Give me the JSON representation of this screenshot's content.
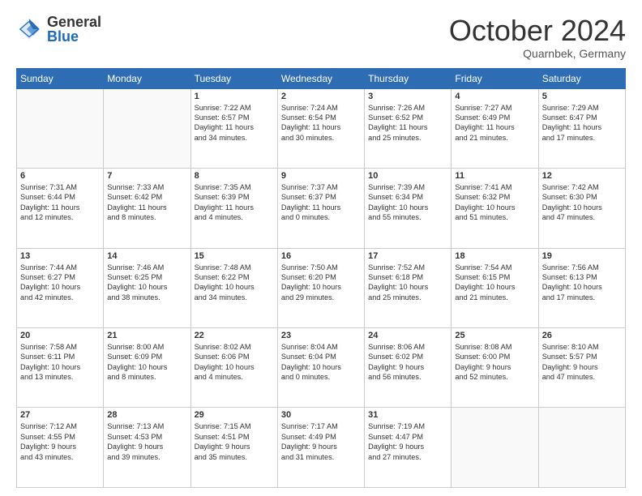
{
  "header": {
    "logo_general": "General",
    "logo_blue": "Blue",
    "month_title": "October 2024",
    "location": "Quarnbek, Germany"
  },
  "weekdays": [
    "Sunday",
    "Monday",
    "Tuesday",
    "Wednesday",
    "Thursday",
    "Friday",
    "Saturday"
  ],
  "weeks": [
    [
      {
        "day": "",
        "lines": []
      },
      {
        "day": "",
        "lines": []
      },
      {
        "day": "1",
        "lines": [
          "Sunrise: 7:22 AM",
          "Sunset: 6:57 PM",
          "Daylight: 11 hours",
          "and 34 minutes."
        ]
      },
      {
        "day": "2",
        "lines": [
          "Sunrise: 7:24 AM",
          "Sunset: 6:54 PM",
          "Daylight: 11 hours",
          "and 30 minutes."
        ]
      },
      {
        "day": "3",
        "lines": [
          "Sunrise: 7:26 AM",
          "Sunset: 6:52 PM",
          "Daylight: 11 hours",
          "and 25 minutes."
        ]
      },
      {
        "day": "4",
        "lines": [
          "Sunrise: 7:27 AM",
          "Sunset: 6:49 PM",
          "Daylight: 11 hours",
          "and 21 minutes."
        ]
      },
      {
        "day": "5",
        "lines": [
          "Sunrise: 7:29 AM",
          "Sunset: 6:47 PM",
          "Daylight: 11 hours",
          "and 17 minutes."
        ]
      }
    ],
    [
      {
        "day": "6",
        "lines": [
          "Sunrise: 7:31 AM",
          "Sunset: 6:44 PM",
          "Daylight: 11 hours",
          "and 12 minutes."
        ]
      },
      {
        "day": "7",
        "lines": [
          "Sunrise: 7:33 AM",
          "Sunset: 6:42 PM",
          "Daylight: 11 hours",
          "and 8 minutes."
        ]
      },
      {
        "day": "8",
        "lines": [
          "Sunrise: 7:35 AM",
          "Sunset: 6:39 PM",
          "Daylight: 11 hours",
          "and 4 minutes."
        ]
      },
      {
        "day": "9",
        "lines": [
          "Sunrise: 7:37 AM",
          "Sunset: 6:37 PM",
          "Daylight: 11 hours",
          "and 0 minutes."
        ]
      },
      {
        "day": "10",
        "lines": [
          "Sunrise: 7:39 AM",
          "Sunset: 6:34 PM",
          "Daylight: 10 hours",
          "and 55 minutes."
        ]
      },
      {
        "day": "11",
        "lines": [
          "Sunrise: 7:41 AM",
          "Sunset: 6:32 PM",
          "Daylight: 10 hours",
          "and 51 minutes."
        ]
      },
      {
        "day": "12",
        "lines": [
          "Sunrise: 7:42 AM",
          "Sunset: 6:30 PM",
          "Daylight: 10 hours",
          "and 47 minutes."
        ]
      }
    ],
    [
      {
        "day": "13",
        "lines": [
          "Sunrise: 7:44 AM",
          "Sunset: 6:27 PM",
          "Daylight: 10 hours",
          "and 42 minutes."
        ]
      },
      {
        "day": "14",
        "lines": [
          "Sunrise: 7:46 AM",
          "Sunset: 6:25 PM",
          "Daylight: 10 hours",
          "and 38 minutes."
        ]
      },
      {
        "day": "15",
        "lines": [
          "Sunrise: 7:48 AM",
          "Sunset: 6:22 PM",
          "Daylight: 10 hours",
          "and 34 minutes."
        ]
      },
      {
        "day": "16",
        "lines": [
          "Sunrise: 7:50 AM",
          "Sunset: 6:20 PM",
          "Daylight: 10 hours",
          "and 29 minutes."
        ]
      },
      {
        "day": "17",
        "lines": [
          "Sunrise: 7:52 AM",
          "Sunset: 6:18 PM",
          "Daylight: 10 hours",
          "and 25 minutes."
        ]
      },
      {
        "day": "18",
        "lines": [
          "Sunrise: 7:54 AM",
          "Sunset: 6:15 PM",
          "Daylight: 10 hours",
          "and 21 minutes."
        ]
      },
      {
        "day": "19",
        "lines": [
          "Sunrise: 7:56 AM",
          "Sunset: 6:13 PM",
          "Daylight: 10 hours",
          "and 17 minutes."
        ]
      }
    ],
    [
      {
        "day": "20",
        "lines": [
          "Sunrise: 7:58 AM",
          "Sunset: 6:11 PM",
          "Daylight: 10 hours",
          "and 13 minutes."
        ]
      },
      {
        "day": "21",
        "lines": [
          "Sunrise: 8:00 AM",
          "Sunset: 6:09 PM",
          "Daylight: 10 hours",
          "and 8 minutes."
        ]
      },
      {
        "day": "22",
        "lines": [
          "Sunrise: 8:02 AM",
          "Sunset: 6:06 PM",
          "Daylight: 10 hours",
          "and 4 minutes."
        ]
      },
      {
        "day": "23",
        "lines": [
          "Sunrise: 8:04 AM",
          "Sunset: 6:04 PM",
          "Daylight: 10 hours",
          "and 0 minutes."
        ]
      },
      {
        "day": "24",
        "lines": [
          "Sunrise: 8:06 AM",
          "Sunset: 6:02 PM",
          "Daylight: 9 hours",
          "and 56 minutes."
        ]
      },
      {
        "day": "25",
        "lines": [
          "Sunrise: 8:08 AM",
          "Sunset: 6:00 PM",
          "Daylight: 9 hours",
          "and 52 minutes."
        ]
      },
      {
        "day": "26",
        "lines": [
          "Sunrise: 8:10 AM",
          "Sunset: 5:57 PM",
          "Daylight: 9 hours",
          "and 47 minutes."
        ]
      }
    ],
    [
      {
        "day": "27",
        "lines": [
          "Sunrise: 7:12 AM",
          "Sunset: 4:55 PM",
          "Daylight: 9 hours",
          "and 43 minutes."
        ]
      },
      {
        "day": "28",
        "lines": [
          "Sunrise: 7:13 AM",
          "Sunset: 4:53 PM",
          "Daylight: 9 hours",
          "and 39 minutes."
        ]
      },
      {
        "day": "29",
        "lines": [
          "Sunrise: 7:15 AM",
          "Sunset: 4:51 PM",
          "Daylight: 9 hours",
          "and 35 minutes."
        ]
      },
      {
        "day": "30",
        "lines": [
          "Sunrise: 7:17 AM",
          "Sunset: 4:49 PM",
          "Daylight: 9 hours",
          "and 31 minutes."
        ]
      },
      {
        "day": "31",
        "lines": [
          "Sunrise: 7:19 AM",
          "Sunset: 4:47 PM",
          "Daylight: 9 hours",
          "and 27 minutes."
        ]
      },
      {
        "day": "",
        "lines": []
      },
      {
        "day": "",
        "lines": []
      }
    ]
  ]
}
